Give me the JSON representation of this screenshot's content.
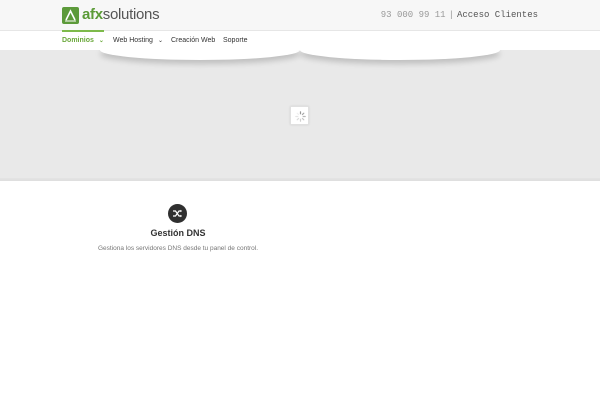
{
  "header": {
    "logo_text_bold": "afx",
    "logo_text_rest": "solutions",
    "phone": "93 000 99 11",
    "separator": "|",
    "login_label": "Acceso Clientes"
  },
  "nav": {
    "items": [
      {
        "label": "Dominios",
        "has_caret": true,
        "active": true
      },
      {
        "label": "Web Hosting",
        "has_caret": true,
        "active": false
      },
      {
        "label": "Creación Web",
        "has_caret": false,
        "active": false
      },
      {
        "label": "Soporte",
        "has_caret": false,
        "active": false
      }
    ],
    "caret": "⌄"
  },
  "feature": {
    "icon": "shuffle-icon",
    "title": "Gestión DNS",
    "description": "Gestiona los servidores DNS desde tu panel de control."
  },
  "colors": {
    "brand_green": "#5c9a3a",
    "active_nav": "#6aa83a",
    "hero_bg": "#e9e9e9",
    "icon_bg": "#2f2f2f"
  }
}
